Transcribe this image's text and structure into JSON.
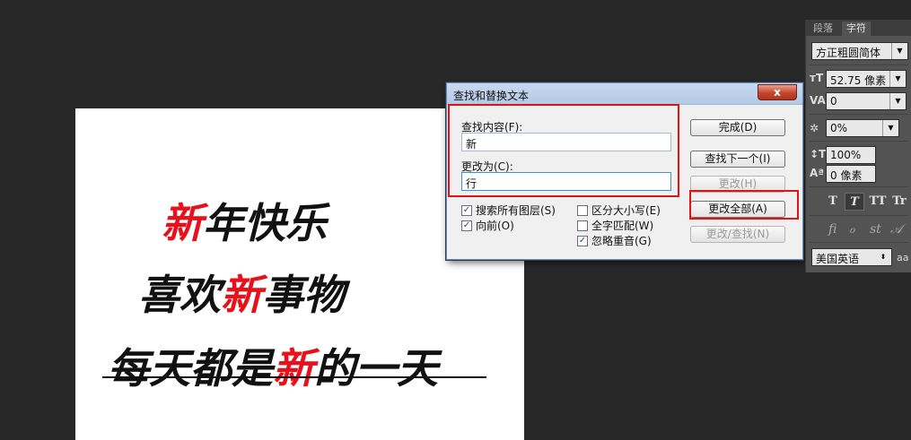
{
  "document": {
    "line1": {
      "red": "新",
      "rest": "年快乐"
    },
    "line2": {
      "pre": "喜欢",
      "red": "新",
      "post": "事物"
    },
    "line3": {
      "pre": "每天都是",
      "red": "新",
      "post": "的一天"
    }
  },
  "dialog": {
    "title": "查找和替换文本",
    "close_label": "x",
    "find_label": "查找内容(F):",
    "find_value": "新",
    "replace_label": "更改为(C):",
    "replace_value": "行",
    "buttons": {
      "done": "完成(D)",
      "find_next": "查找下一个(I)",
      "change": "更改(H)",
      "change_all": "更改全部(A)",
      "change_find": "更改/查找(N)"
    },
    "options": {
      "all_layers": {
        "label": "搜索所有图层(S)",
        "checked": true
      },
      "forward": {
        "label": "向前(O)",
        "checked": true
      },
      "case_sensitive": {
        "label": "区分大小写(E)",
        "checked": false
      },
      "whole_word": {
        "label": "全字匹配(W)",
        "checked": false
      },
      "ignore_accents": {
        "label": "忽略重音(G)",
        "checked": true
      }
    }
  },
  "panel": {
    "tabs": [
      "段落",
      "字符"
    ],
    "font_family": "方正粗圆简体",
    "font_size": "52.75 像素",
    "kerning": "0",
    "tracking": "0%",
    "vertical_scale": "100%",
    "baseline_shift": "0 像素",
    "style_buttons": [
      "T",
      "T",
      "TT",
      "Tr"
    ],
    "language": "美国英语",
    "antialias_icon": "aa"
  },
  "icons": {
    "check": "✓",
    "chevron": "▼",
    "updown": "⬍"
  }
}
